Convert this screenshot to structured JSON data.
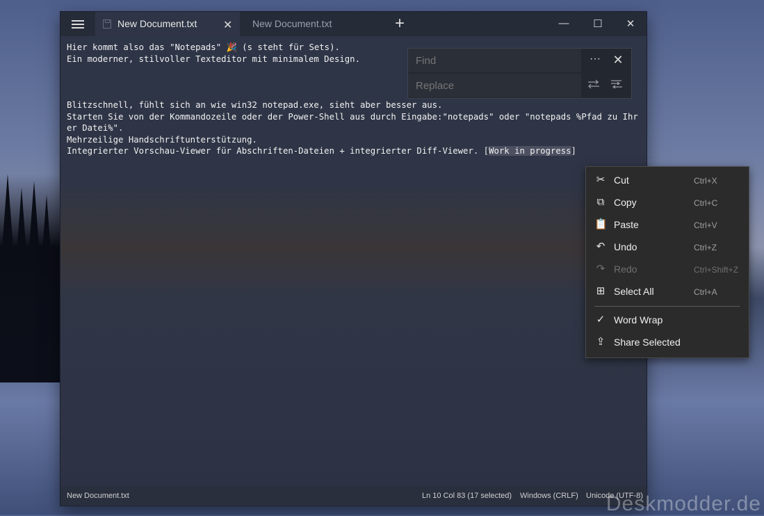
{
  "tabs": [
    {
      "label": "New Document.txt",
      "active": true
    },
    {
      "label": "New Document.txt",
      "active": false
    }
  ],
  "window_controls": {
    "minimize": "—",
    "maximize": "☐",
    "close": "✕"
  },
  "editor": {
    "lines": [
      "Hier kommt also das \"Notepads\" 🎉 (s steht für Sets).",
      "Ein moderner, stilvoller Texteditor mit minimalem Design.",
      "",
      "",
      "",
      "Blitzschnell, fühlt sich an wie win32 notepad.exe, sieht aber besser aus.",
      "Starten Sie von der Kommandozeile oder der Power-Shell aus durch Eingabe:\"notepads\" oder \"notepads %Pfad zu Ihrer Datei%\".",
      "Mehrzeilige Handschriftunterstützung.",
      "Integrierter Vorschau-Viewer für Abschriften-Dateien + integrierter Diff-Viewer. ["
    ],
    "selected_text": "Work in progress",
    "after_selection": "]"
  },
  "find_replace": {
    "find_placeholder": "Find",
    "replace_placeholder": "Replace",
    "more_icon": "···"
  },
  "context_menu": {
    "items": [
      {
        "label": "Cut",
        "shortcut": "Ctrl+X",
        "icon": "scissors-icon",
        "enabled": true
      },
      {
        "label": "Copy",
        "shortcut": "Ctrl+C",
        "icon": "copy-icon",
        "enabled": true
      },
      {
        "label": "Paste",
        "shortcut": "Ctrl+V",
        "icon": "paste-icon",
        "enabled": true
      },
      {
        "label": "Undo",
        "shortcut": "Ctrl+Z",
        "icon": "undo-icon",
        "enabled": true
      },
      {
        "label": "Redo",
        "shortcut": "Ctrl+Shift+Z",
        "icon": "redo-icon",
        "enabled": false
      },
      {
        "label": "Select All",
        "shortcut": "Ctrl+A",
        "icon": "select-all-icon",
        "enabled": true
      },
      {
        "label": "Word Wrap",
        "shortcut": "",
        "icon": "check-icon",
        "enabled": true
      },
      {
        "label": "Share Selected",
        "shortcut": "",
        "icon": "share-icon",
        "enabled": true
      }
    ]
  },
  "statusbar": {
    "file_name": "New Document.txt",
    "position": "Ln 10 Col 83 (17 selected)",
    "line_ending": "Windows (CRLF)",
    "encoding": "Unicode (UTF-8)"
  },
  "watermark": "Deskmodder.de",
  "colors": {
    "window_bg": "#2f3546",
    "menu_bg": "#2b2b2b",
    "selection": "#4c5060"
  }
}
